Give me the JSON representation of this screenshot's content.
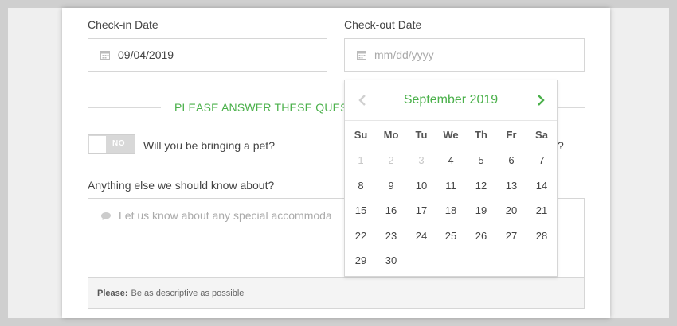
{
  "checkin": {
    "label": "Check-in Date",
    "value": "09/04/2019"
  },
  "checkout": {
    "label": "Check-out Date",
    "placeholder": "mm/dd/yyyy"
  },
  "section": {
    "title": "PLEASE ANSWER THESE QUEST"
  },
  "pet": {
    "toggle_text": "NO",
    "question": "Will you be bringing a pet?",
    "hidden_fragment": "?"
  },
  "notes": {
    "label": "Anything else we should know about?",
    "placeholder": "Let us know about any special accommoda",
    "hint_strong": "Please:",
    "hint_text": "Be as descriptive as possible"
  },
  "datepicker": {
    "month": "September 2019",
    "weekdays": [
      "Su",
      "Mo",
      "Tu",
      "We",
      "Th",
      "Fr",
      "Sa"
    ],
    "weeks": [
      [
        {
          "d": "1",
          "m": true
        },
        {
          "d": "2",
          "m": true
        },
        {
          "d": "3",
          "m": true
        },
        {
          "d": "4"
        },
        {
          "d": "5"
        },
        {
          "d": "6"
        },
        {
          "d": "7"
        }
      ],
      [
        {
          "d": "8"
        },
        {
          "d": "9"
        },
        {
          "d": "10"
        },
        {
          "d": "11"
        },
        {
          "d": "12"
        },
        {
          "d": "13"
        },
        {
          "d": "14"
        }
      ],
      [
        {
          "d": "15"
        },
        {
          "d": "16"
        },
        {
          "d": "17"
        },
        {
          "d": "18"
        },
        {
          "d": "19"
        },
        {
          "d": "20"
        },
        {
          "d": "21"
        }
      ],
      [
        {
          "d": "22"
        },
        {
          "d": "23"
        },
        {
          "d": "24"
        },
        {
          "d": "25"
        },
        {
          "d": "26"
        },
        {
          "d": "27"
        },
        {
          "d": "28"
        }
      ],
      [
        {
          "d": "29"
        },
        {
          "d": "30"
        }
      ]
    ]
  },
  "colors": {
    "accent": "#4ab04a",
    "muted": "#c8c8c8"
  },
  "icons": {
    "calendar": "calendar-icon",
    "chat": "chat-bubble-icon",
    "prev": "chevron-left-icon",
    "next": "chevron-right-icon"
  }
}
